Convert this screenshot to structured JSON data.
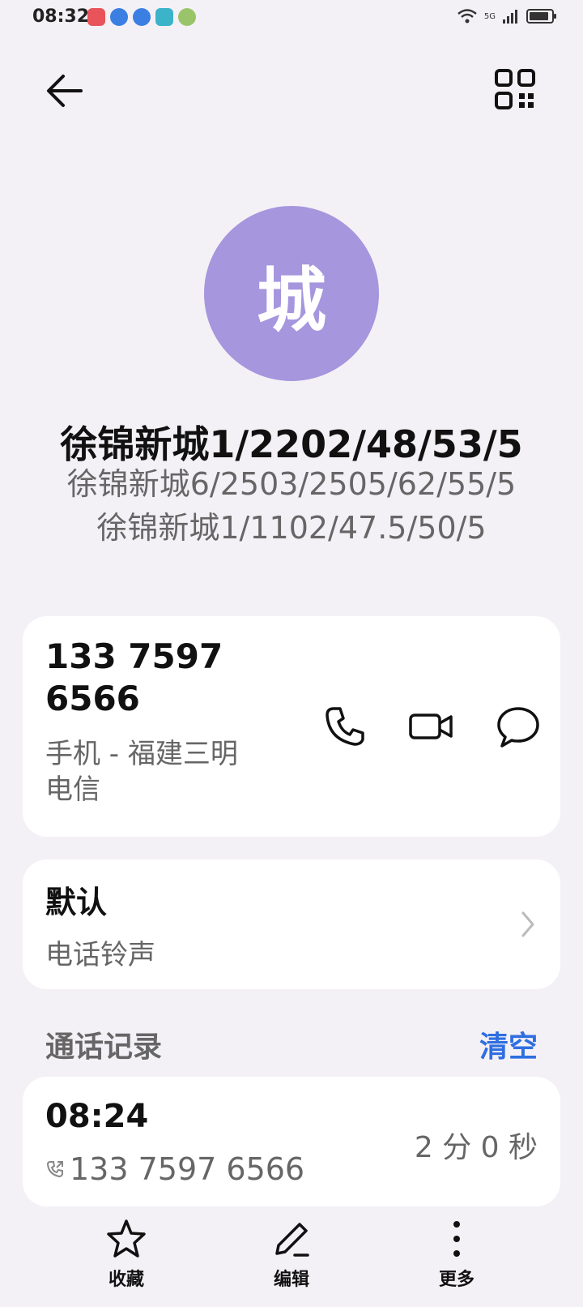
{
  "status_bar": {
    "time": "08:32",
    "network": "5G",
    "battery_level": 0.9
  },
  "header": {
    "back_icon": "arrow-left-icon",
    "qr_icon": "qr-code-icon"
  },
  "contact": {
    "avatar_text": "城",
    "avatar_color": "#a596de",
    "name": "徐锦新城1/2202/48/53/5",
    "alt_names": [
      "徐锦新城6/2503/2505/62/55/5",
      "徐锦新城1/1102/47.5/50/5"
    ]
  },
  "phone": {
    "number_line1": "133 7597",
    "number_line2": "6566",
    "label_line1": "手机 - 福建三明",
    "label_line2": "电信"
  },
  "ringtone": {
    "title": "默认",
    "subtitle": "电话铃声"
  },
  "call_log": {
    "section_title": "通话记录",
    "clear_label": "清空",
    "accent_color": "#2f6fe0",
    "entries": [
      {
        "time": "08:24",
        "number": "133 7597 6566",
        "duration": "2 分 0 秒"
      }
    ]
  },
  "bottom_bar": {
    "favorite_label": "收藏",
    "edit_label": "编辑",
    "more_label": "更多"
  }
}
